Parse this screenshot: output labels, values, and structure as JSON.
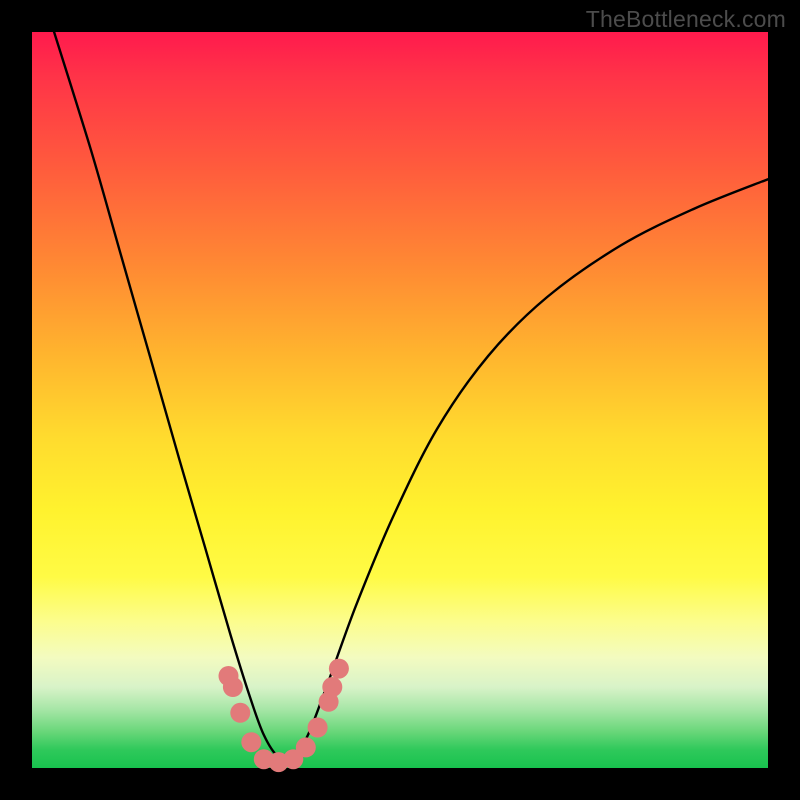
{
  "watermark": "TheBottleneck.com",
  "chart_data": {
    "type": "line",
    "title": "",
    "xlabel": "",
    "ylabel": "",
    "xlim": [
      0,
      1
    ],
    "ylim": [
      0,
      1
    ],
    "gradient_meaning": "vertical color gradient: red=1 (top) → green=0 (bottom)",
    "series": [
      {
        "name": "bottleneck-curve",
        "x": [
          0.03,
          0.08,
          0.12,
          0.16,
          0.2,
          0.235,
          0.27,
          0.295,
          0.315,
          0.335,
          0.355,
          0.375,
          0.4,
          0.44,
          0.49,
          0.55,
          0.62,
          0.7,
          0.8,
          0.9,
          1.0
        ],
        "y": [
          1.0,
          0.84,
          0.7,
          0.56,
          0.42,
          0.3,
          0.18,
          0.1,
          0.045,
          0.015,
          0.015,
          0.045,
          0.11,
          0.22,
          0.34,
          0.46,
          0.56,
          0.64,
          0.71,
          0.76,
          0.8
        ]
      }
    ],
    "markers": {
      "name": "highlighted-points",
      "color": "#e27a7a",
      "points": [
        {
          "x": 0.267,
          "y": 0.125
        },
        {
          "x": 0.273,
          "y": 0.11
        },
        {
          "x": 0.283,
          "y": 0.075
        },
        {
          "x": 0.298,
          "y": 0.035
        },
        {
          "x": 0.315,
          "y": 0.012
        },
        {
          "x": 0.335,
          "y": 0.008
        },
        {
          "x": 0.355,
          "y": 0.012
        },
        {
          "x": 0.372,
          "y": 0.028
        },
        {
          "x": 0.388,
          "y": 0.055
        },
        {
          "x": 0.403,
          "y": 0.09
        },
        {
          "x": 0.408,
          "y": 0.11
        },
        {
          "x": 0.417,
          "y": 0.135
        }
      ]
    }
  }
}
